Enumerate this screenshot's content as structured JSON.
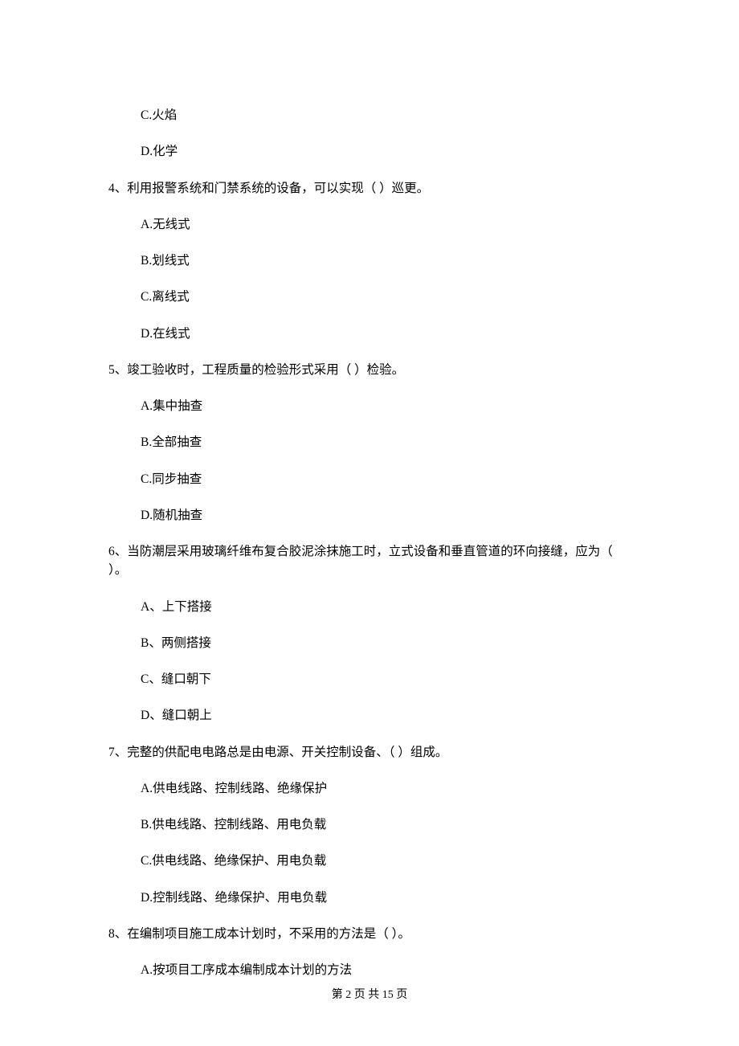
{
  "prev_q_options": {
    "c": "C.火焰",
    "d": "D.化学"
  },
  "q4": {
    "stem": "4、利用报警系统和门禁系统的设备，可以实现（    ）巡更。",
    "a": "A.无线式",
    "b": "B.划线式",
    "c": "C.离线式",
    "d": "D.在线式"
  },
  "q5": {
    "stem": "5、竣工验收时，工程质量的检验形式采用（    ）检验。",
    "a": "A.集中抽查",
    "b": "B.全部抽查",
    "c": "C.同步抽查",
    "d": "D.随机抽查"
  },
  "q6": {
    "stem": "6、当防潮层采用玻璃纤维布复合胶泥涂抹施工时，立式设备和垂直管道的环向接缝，应为（    ）。",
    "a": "A、上下搭接",
    "b": "B、两侧搭接",
    "c": "C、缝口朝下",
    "d": "D、缝口朝上"
  },
  "q7": {
    "stem": "7、完整的供配电电路总是由电源、开关控制设备、（    ）组成。",
    "a": "A.供电线路、控制线路、绝缘保护",
    "b": "B.供电线路、控制线路、用电负载",
    "c": "C.供电线路、绝缘保护、用电负载",
    "d": "D.控制线路、绝缘保护、用电负载"
  },
  "q8": {
    "stem": "8、在编制项目施工成本计划时，不采用的方法是（    ）。",
    "a": "A.按项目工序成本编制成本计划的方法"
  },
  "footer": "第 2 页 共 15 页"
}
